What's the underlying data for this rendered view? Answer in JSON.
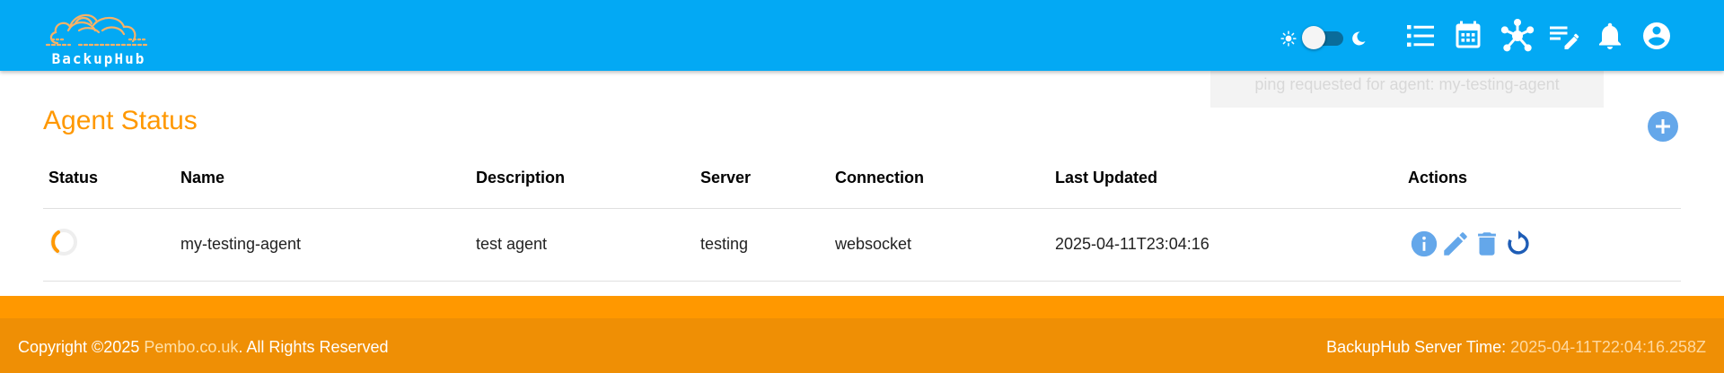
{
  "app": {
    "name": "BackupHub"
  },
  "header": {
    "theme_toggle": {
      "mode": "light"
    },
    "icons": [
      "list-icon",
      "calendar-icon",
      "hub-icon",
      "edit-note-icon",
      "bell-icon",
      "account-icon"
    ]
  },
  "toast": {
    "message": "ping requested for agent: my-testing-agent"
  },
  "page": {
    "title": "Agent Status"
  },
  "table": {
    "headers": {
      "status": "Status",
      "name": "Name",
      "description": "Description",
      "server": "Server",
      "connection": "Connection",
      "last_updated": "Last Updated",
      "actions": "Actions"
    },
    "rows": [
      {
        "status": "loading",
        "name": "my-testing-agent",
        "description": "test agent",
        "server": "testing",
        "connection": "websocket",
        "last_updated": "2025-04-11T23:04:16",
        "actions": [
          "info-icon",
          "edit-icon",
          "delete-icon",
          "refresh-icon"
        ]
      }
    ]
  },
  "footer": {
    "copyright_prefix": "Copyright ©2025 ",
    "copyright_link": "Pembo.co.uk",
    "copyright_suffix": ". All Rights Reserved",
    "server_time_label": "BackupHub Server Time: ",
    "server_time_value": "2025-04-11T22:04:16.258Z"
  },
  "colors": {
    "header": "#03a9f4",
    "accent": "#ff9800",
    "footer": "#ef8f05",
    "action_icon": "#64a7ea",
    "refresh_icon": "#1e5db6"
  }
}
